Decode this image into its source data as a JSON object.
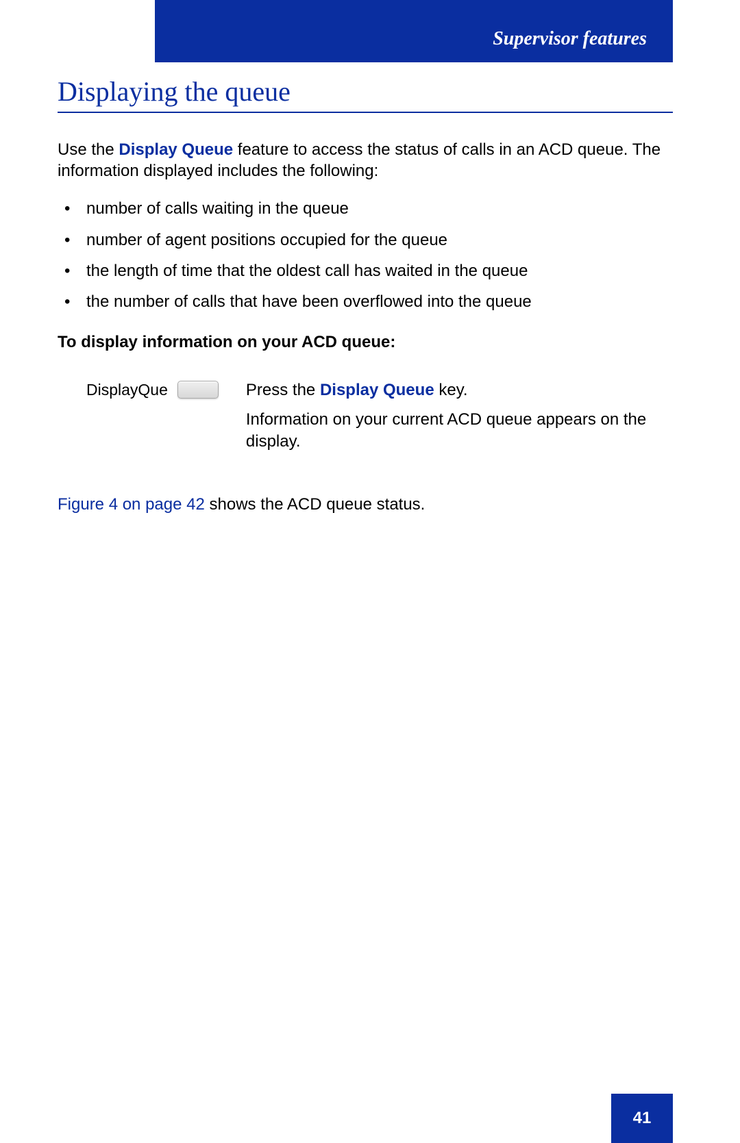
{
  "header": {
    "section": "Supervisor features"
  },
  "title": "Displaying the queue",
  "intro": {
    "prefix": "Use the ",
    "feature_name": "Display Queue",
    "suffix": " feature to access the status of calls in an ACD queue. The information displayed includes the following:"
  },
  "bullets": [
    "number of calls waiting in the queue",
    "number of agent positions occupied for the queue",
    "the length of time that the oldest call has waited in the queue",
    "the number of calls that have been overflowed into the queue"
  ],
  "subsection": "To display information on your ACD queue:",
  "instruction": {
    "key_label": "DisplayQue",
    "line1_prefix": "Press the ",
    "line1_bold": "Display Queue",
    "line1_suffix": " key.",
    "line2": "Information on your current ACD queue appears on the display."
  },
  "reference": {
    "link_text": "Figure 4 on page 42",
    "rest": " shows the ACD queue status."
  },
  "page_number": "41"
}
